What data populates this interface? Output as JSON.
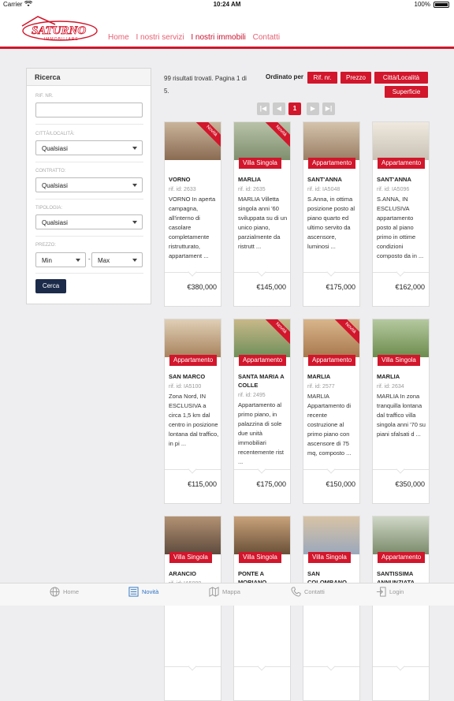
{
  "status_bar": {
    "carrier": "Carrier",
    "time": "10:24 AM",
    "battery": "100%"
  },
  "brand": {
    "logo_main": "SATURNO",
    "logo_sub": "IMMOBILIARE",
    "accent": "#d2162b"
  },
  "nav": {
    "home": "Home",
    "servizi": "I nostri servizi",
    "immobili": "I nostri immobili",
    "contatti": "Contatti"
  },
  "sidebar": {
    "title": "Ricerca",
    "rif_label": "RIF. NR.",
    "citta_label": "CITTÀ/LOCALITÀ:",
    "citta_value": "Qualsiasi",
    "contratto_label": "CONTRATTO:",
    "contratto_value": "Qualsiasi",
    "tipologia_label": "TIPOLOGIA:",
    "tipologia_value": "Qualsiasi",
    "prezzo_label": "PREZZO:",
    "min_value": "Min",
    "dash": "-",
    "max_value": "Max",
    "search_label": "Cerca"
  },
  "results": {
    "summary": "99 risultati trovati. Pagina 1 di 5.",
    "sort_label": "Ordinato per",
    "sort_rif": "Rif. nr.",
    "sort_prezzo": "Prezzo",
    "sort_citta": "Città/Località",
    "sort_superficie": "Superficie"
  },
  "pagination": {
    "first": "|◀",
    "prev": "◀",
    "current": "1",
    "next": "▶",
    "last": "▶|"
  },
  "listings": [
    {
      "title": "VORNO",
      "ref": "rif. id: 2633",
      "desc": "VORNO In aperta campagna, all'interno di casolare completamente ristrutturato, appartament ...",
      "price": "€380,000",
      "badge": "",
      "novita": "Novità"
    },
    {
      "title": "MARLIA",
      "ref": "rif. id: 2635",
      "desc": "MARLIA Villetta singola anni '60 sviluppata su di un unico piano, parzialmente da ristrutt ...",
      "price": "€145,000",
      "badge": "Villa Singola",
      "novita": "Novità"
    },
    {
      "title": "SANT'ANNA",
      "ref": "rif. id: IA5048",
      "desc": "S.Anna, in ottima posizione posto al piano quarto ed ultimo servito da ascensore, luminosi ...",
      "price": "€175,000",
      "badge": "Appartamento",
      "novita": ""
    },
    {
      "title": "SANT'ANNA",
      "ref": "rif. id: IA5096",
      "desc": "S.ANNA, IN ESCLUSIVA appartamento posto al piano primo in ottime condizioni composto da in ...",
      "price": "€162,000",
      "badge": "Appartamento",
      "novita": ""
    },
    {
      "title": "SAN MARCO",
      "ref": "rif. id: IA5100",
      "desc": "Zona Nord, IN ESCLUSIVA a circa 1,5 km dal centro in posizione lontana dal traffico, in pi ...",
      "price": "€115,000",
      "badge": "Appartamento",
      "novita": ""
    },
    {
      "title": "SANTA MARIA A COLLE",
      "ref": "rif. id: 2495",
      "desc": "Appartamento al primo piano, in palazzina di sole due unità immobiliari recentemente rist ...",
      "price": "€175,000",
      "badge": "Appartamento",
      "novita": "Novità"
    },
    {
      "title": "MARLIA",
      "ref": "rif. id: 2577",
      "desc": "MARLIA Appartamento di recente costruzione al primo piano con ascensore di 75 mq, composto ...",
      "price": "€150,000",
      "badge": "Appartamento",
      "novita": "Novità"
    },
    {
      "title": "MARLIA",
      "ref": "rif. id: 2634",
      "desc": "MARLIA In zona tranquilla lontana dal traffico villa singola anni '70 su piani sfalsati d ...",
      "price": "€350,000",
      "badge": "Villa Singola",
      "novita": ""
    },
    {
      "title": "ARANCIO",
      "ref": "rif. id: IA5000",
      "desc": "",
      "price": "",
      "badge": "Villa Singola",
      "novita": ""
    },
    {
      "title": "PONTE A MORIANO",
      "ref": "",
      "desc": "",
      "price": "",
      "badge": "Villa Singola",
      "novita": ""
    },
    {
      "title": "SAN COLOMBANO",
      "ref": "",
      "desc": "",
      "price": "",
      "badge": "Villa Singola",
      "novita": ""
    },
    {
      "title": "SANTISSIMA ANNUNZIATA",
      "ref": "",
      "desc": "",
      "price": "",
      "badge": "Appartamento",
      "novita": ""
    }
  ],
  "tabbar": {
    "home": "Home",
    "novita": "Novità",
    "mappa": "Mappa",
    "contatti": "Contatti",
    "login": "Login"
  },
  "icons": [
    "wifi-icon",
    "battery-icon",
    "globe-icon",
    "list-icon",
    "map-icon",
    "phone-icon",
    "login-icon",
    "chevron-down-icon"
  ]
}
